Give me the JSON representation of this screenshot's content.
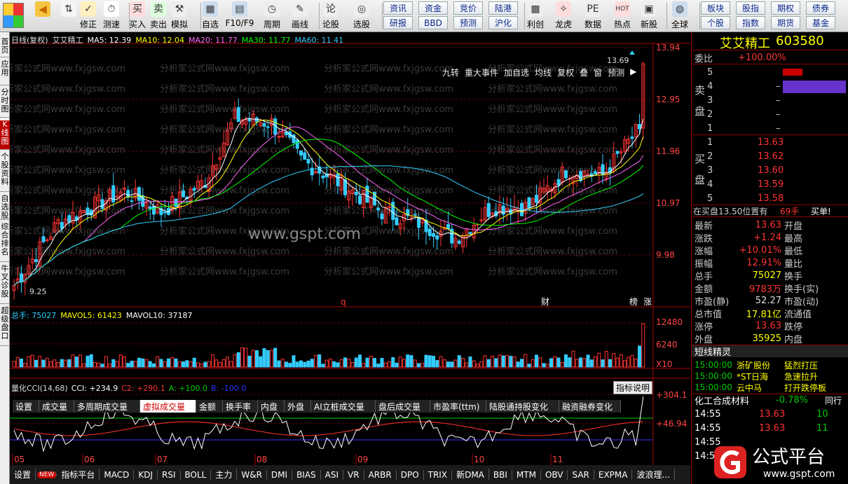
{
  "toolbar": {
    "buttons": [
      "修正",
      "测速",
      "买入",
      "卖出",
      "模拟",
      "自选",
      "F10/F9",
      "周期",
      "画线",
      "论股",
      "选股",
      "利创",
      "龙虎",
      "数据",
      "热点",
      "新股",
      "全球"
    ],
    "tiles": [
      "资讯",
      "资金",
      "竞价",
      "陆港",
      "研报",
      "BBD",
      "预测",
      "沪化"
    ],
    "tiles_right": [
      "板块",
      "股指",
      "期权",
      "债券",
      "个股",
      "指数",
      "期货",
      "基金"
    ]
  },
  "left_tabs": [
    "首页",
    "应用",
    "分时图",
    "K线图",
    "个股资料",
    "自选股",
    "综合排名",
    "牛叉诊股",
    "超级盘口"
  ],
  "chart": {
    "header": {
      "mode": "日线(复权)",
      "name": "艾艾精工",
      "ma": [
        {
          "t": "MA5: 12.39",
          "c": "#ffffff"
        },
        {
          "t": "MA10: 12.04",
          "c": "#ffff00"
        },
        {
          "t": "MA20: 11.77",
          "c": "#ff66ff"
        },
        {
          "t": "MA30: 11.77",
          "c": "#00ff00"
        },
        {
          "t": "MA60: 11.41",
          "c": "#33ccff"
        }
      ]
    },
    "menu": [
      "九转",
      "重大事件",
      "加自选",
      "均线",
      "复权",
      "叠",
      "窗",
      "预测"
    ],
    "price_ticks": [
      "13.94",
      "12.95",
      "11.96",
      "10.97",
      "9.98"
    ],
    "high_label": "13.69",
    "low_label": "9.25",
    "events": [
      "q",
      "财",
      "榜",
      "涨"
    ],
    "watermark_mid": "www.gspt.com",
    "watermark": "分析家公式网www.fxjgsw.com",
    "vol_header": {
      "total": "总手: 75027",
      "mavol5": "MAVOL5: 61423",
      "mavol10": "MAVOL10: 37187"
    },
    "vol_ticks": [
      "12480",
      "6240",
      "X10"
    ],
    "tabs": [
      "设置",
      "成交量",
      "多周期成交量",
      "虚拟成交量",
      "金额",
      "换手率",
      "内盘",
      "外盘",
      "AI立桩成交量",
      "盘后成交量",
      "市盈率(ttm)",
      "陆股通持股变化",
      "融资融券变化"
    ],
    "cci_header": {
      "name": "量化CCI(14,68)",
      "cci": "CCI: +234.9",
      "c2": "C2: +290.1",
      "a": "A: +100.0",
      "b": "B: -100.0"
    },
    "cci_btn": "指标说明",
    "cci_ticks": [
      "+304.1",
      "+46.94"
    ],
    "months": [
      "05",
      "06",
      "07",
      "08",
      "09",
      "10",
      "11"
    ]
  },
  "bottom_tabs": [
    "设置",
    "指标平台",
    "MACD",
    "KDJ",
    "RSI",
    "BOLL",
    "主力",
    "W&R",
    "DMI",
    "BIAS",
    "ASI",
    "VR",
    "ARBR",
    "DPO",
    "TRIX",
    "新DMA",
    "BBI",
    "MTM",
    "OBV",
    "SAR",
    "EXPMA",
    "波浪理..."
  ],
  "panel": {
    "title": "艾艾精工",
    "code": "603580",
    "webi_label": "委比",
    "webi": "+100.00%",
    "sell": [
      {
        "n": "5",
        "p": "",
        "v": ""
      },
      {
        "n": "4",
        "p": "–",
        "v": ""
      },
      {
        "n": "3",
        "p": "–",
        "v": ""
      },
      {
        "n": "2",
        "p": "–",
        "v": ""
      },
      {
        "n": "1",
        "p": "–",
        "v": ""
      }
    ],
    "sell_label": "卖盘",
    "buy_label": "买盘",
    "buy": [
      {
        "n": "1",
        "p": "13.63"
      },
      {
        "n": "2",
        "p": "13.62"
      },
      {
        "n": "3",
        "p": "13.60"
      },
      {
        "n": "4",
        "p": "13.59"
      },
      {
        "n": "5",
        "p": "13.58"
      }
    ],
    "status": "在买盘13.50位置有",
    "status_v": "69手",
    "status_act": "买单!",
    "stats": [
      [
        "最新",
        "13.63",
        "开盘"
      ],
      [
        "涨跌",
        "+1.24",
        "最高"
      ],
      [
        "涨幅",
        "+10.01%",
        "最低"
      ],
      [
        "振幅",
        "12.91%",
        "量比"
      ],
      [
        "总手",
        "75027",
        "换手"
      ],
      [
        "金额",
        "9783万",
        "换手(实)"
      ],
      [
        "市盈(静)",
        "52.27",
        "市盈(动)"
      ],
      [
        "总市值",
        "17.81亿",
        "流通值"
      ],
      [
        "涨停",
        "13.63",
        "跌停"
      ],
      [
        "外盘",
        "35925",
        "内盘"
      ]
    ],
    "sprite_title": "短线精灵",
    "sprite": [
      [
        "15:00:00",
        "浙矿股份",
        "猛烈打压"
      ],
      [
        "15:00:00",
        "*ST日海",
        "急速拉升"
      ],
      [
        "15:00:00",
        "云中马",
        "打开跌停板"
      ]
    ],
    "industry": "化工合成材料",
    "industry_chg": "-0.78%",
    "industry_btn": "同行",
    "ticks": [
      [
        "14:55",
        "13.63",
        "10"
      ],
      [
        "14:55",
        "13.63",
        "11"
      ],
      [
        "14:55",
        "",
        ""
      ],
      [
        "14:56",
        "",
        ""
      ]
    ],
    "logo_text": "公式平台",
    "logo_url": "www.gspt.com"
  }
}
